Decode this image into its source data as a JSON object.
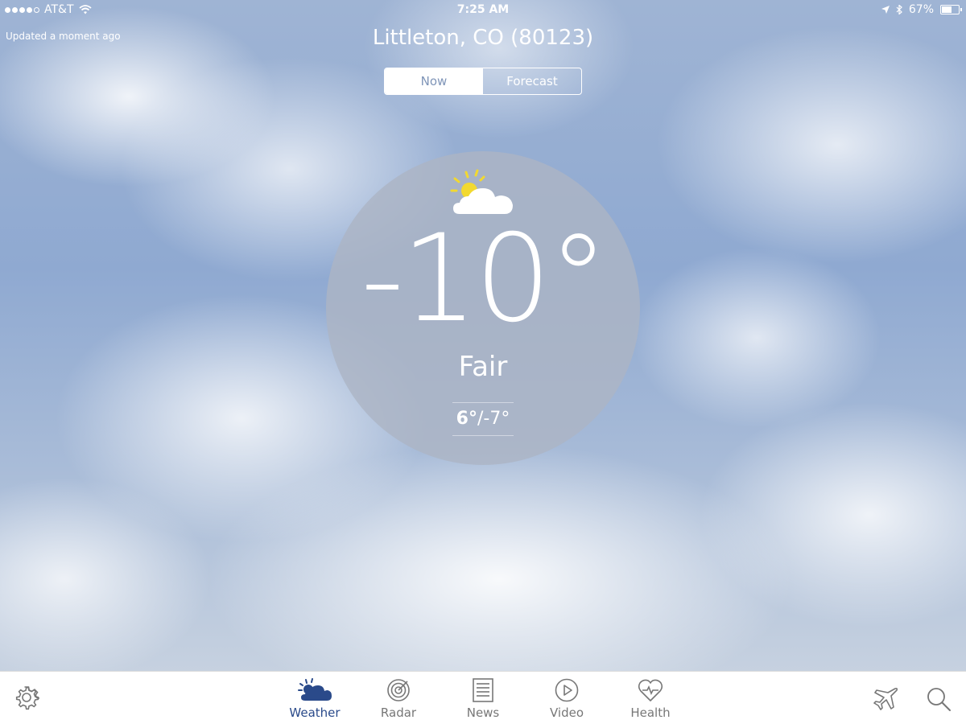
{
  "status_bar": {
    "carrier": "AT&T",
    "time": "7:25 AM",
    "battery": "67%",
    "battery_level": 0.67
  },
  "header": {
    "updated": "Updated a moment ago",
    "location": "Littleton, CO (80123)"
  },
  "view_toggle": {
    "now_label": "Now",
    "forecast_label": "Forecast",
    "selected": "Now"
  },
  "current": {
    "condition_icon": "partly-sunny-icon",
    "temperature": "-10°",
    "condition": "Fair",
    "high": "6°",
    "low": "/-7°"
  },
  "tab_bar": {
    "settings_icon": "gear-icon",
    "items": [
      {
        "label": "Weather",
        "icon": "partly-sunny-icon",
        "active": true
      },
      {
        "label": "Radar",
        "icon": "radar-icon",
        "active": false
      },
      {
        "label": "News",
        "icon": "newspaper-icon",
        "active": false
      },
      {
        "label": "Video",
        "icon": "play-circle-icon",
        "active": false
      },
      {
        "label": "Health",
        "icon": "heart-pulse-icon",
        "active": false
      }
    ],
    "travel_icon": "airplane-icon",
    "search_icon": "search-icon",
    "active_color": "#2a4a8a"
  }
}
